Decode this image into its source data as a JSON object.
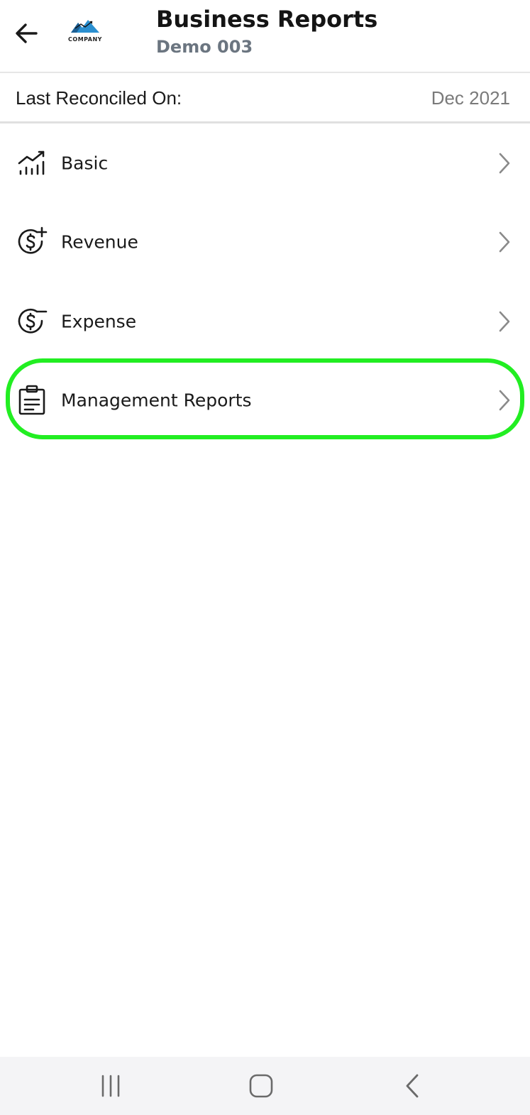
{
  "header": {
    "title": "Business Reports",
    "subtitle": "Demo 003",
    "logo_text": "COMPANY"
  },
  "reconciliation": {
    "label": "Last Reconciled On:",
    "value": "Dec 2021"
  },
  "menu": {
    "items": [
      {
        "label": "Basic",
        "icon": "bar-chart-trend-icon"
      },
      {
        "label": "Revenue",
        "icon": "dollar-plus-icon"
      },
      {
        "label": "Expense",
        "icon": "dollar-minus-icon"
      },
      {
        "label": "Management Reports",
        "icon": "clipboard-icon"
      }
    ]
  },
  "highlight": {
    "target": "Management Reports",
    "color": "#22ee22"
  },
  "colors": {
    "subtitle": "#6b7580",
    "value_text": "#7a7a7a",
    "divider": "#e0e0e0",
    "navbar_bg": "#f4f4f6"
  },
  "navigation_bar": {
    "buttons": [
      "recent-apps-icon",
      "home-icon",
      "back-icon"
    ]
  }
}
